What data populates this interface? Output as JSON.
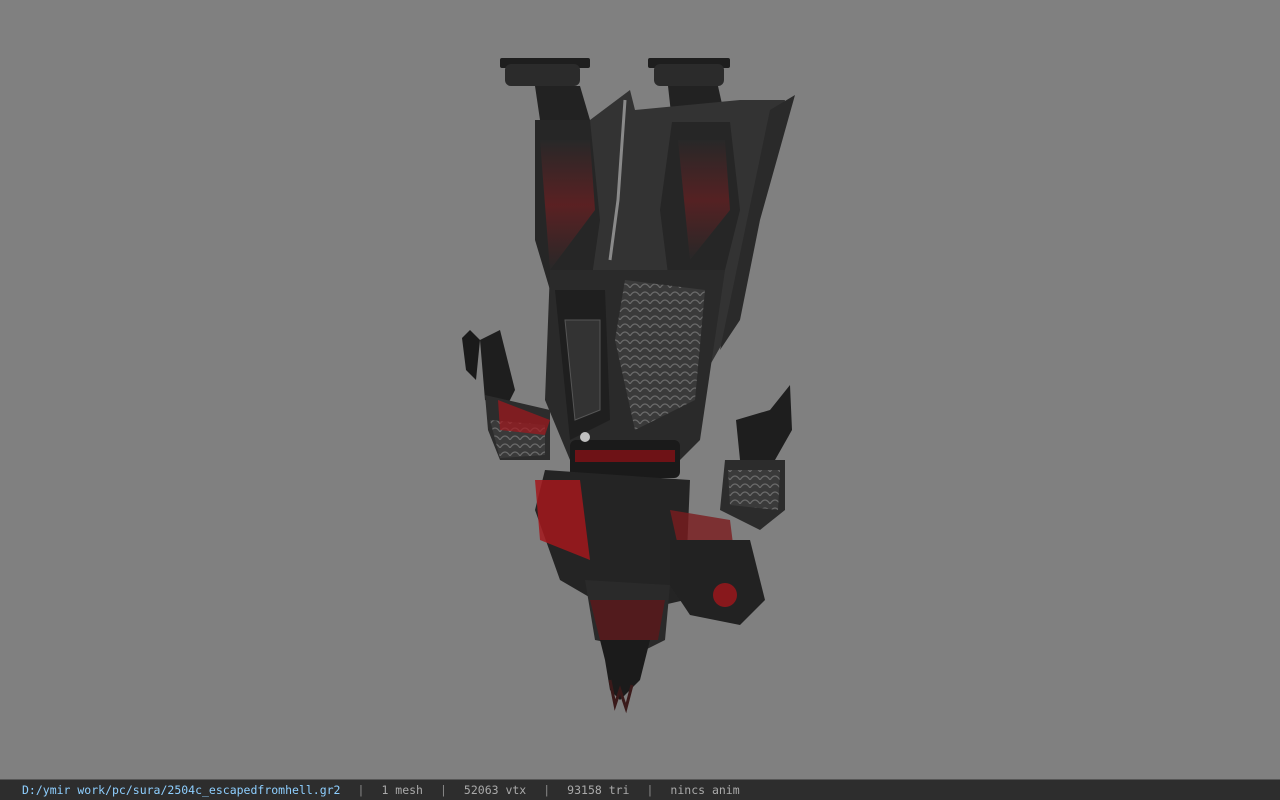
{
  "viewport": {
    "background": "#808080",
    "model": {
      "description": "upside-down armored character model (dark armor with red accents)",
      "colors": {
        "armor": "#2a2a2a",
        "armor_dark": "#151515",
        "accent": "#a3171c",
        "highlight": "#6b6b6b"
      }
    }
  },
  "statusbar": {
    "file_path": "D:/ymir work/pc/sura/2504c_escapedfromhell.gr2",
    "separator": "|",
    "mesh_count": "1 mesh",
    "vertex_count": "52063 vtx",
    "triangle_count": "93158 tri",
    "anim_status": "nincs anim",
    "path_color": "#8ecfff",
    "text_color": "#aaaaaa"
  }
}
